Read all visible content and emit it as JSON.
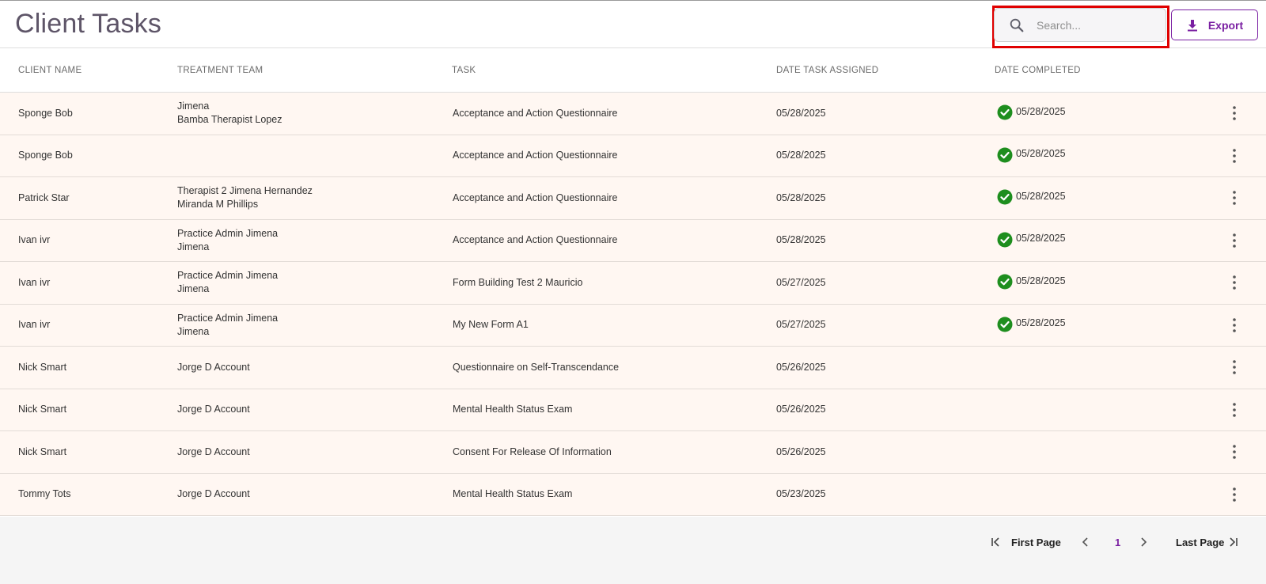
{
  "header": {
    "title": "Client Tasks",
    "search_placeholder": "Search...",
    "export_label": "Export"
  },
  "table": {
    "columns": [
      "CLIENT NAME",
      "TREATMENT TEAM",
      "TASK",
      "DATE TASK ASSIGNED",
      "DATE COMPLETED"
    ],
    "rows": [
      {
        "client": "Sponge Bob",
        "team": [
          "Jimena",
          "Bamba Therapist Lopez"
        ],
        "task": "Acceptance and Action Questionnaire",
        "assigned": "05/28/2025",
        "completed": "05/28/2025"
      },
      {
        "client": "Sponge Bob",
        "team": [],
        "task": "Acceptance and Action Questionnaire",
        "assigned": "05/28/2025",
        "completed": "05/28/2025"
      },
      {
        "client": "Patrick Star",
        "team": [
          "Therapist 2 Jimena Hernandez",
          "Miranda M Phillips"
        ],
        "task": "Acceptance and Action Questionnaire",
        "assigned": "05/28/2025",
        "completed": "05/28/2025"
      },
      {
        "client": "Ivan ivr",
        "team": [
          "Practice Admin Jimena",
          "Jimena"
        ],
        "task": "Acceptance and Action Questionnaire",
        "assigned": "05/28/2025",
        "completed": "05/28/2025"
      },
      {
        "client": "Ivan ivr",
        "team": [
          "Practice Admin Jimena",
          "Jimena"
        ],
        "task": "Form Building Test 2 Mauricio",
        "assigned": "05/27/2025",
        "completed": "05/28/2025"
      },
      {
        "client": "Ivan ivr",
        "team": [
          "Practice Admin Jimena",
          "Jimena"
        ],
        "task": "My New Form A1",
        "assigned": "05/27/2025",
        "completed": "05/28/2025"
      },
      {
        "client": "Nick Smart",
        "team": [
          "Jorge D Account"
        ],
        "task": "Questionnaire on Self-Transcendance",
        "assigned": "05/26/2025",
        "completed": ""
      },
      {
        "client": "Nick Smart",
        "team": [
          "Jorge D Account"
        ],
        "task": "Mental Health Status Exam",
        "assigned": "05/26/2025",
        "completed": ""
      },
      {
        "client": "Nick Smart",
        "team": [
          "Jorge D Account"
        ],
        "task": "Consent For Release Of Information",
        "assigned": "05/26/2025",
        "completed": ""
      },
      {
        "client": "Tommy Tots",
        "team": [
          "Jorge D Account"
        ],
        "task": "Mental Health Status Exam",
        "assigned": "05/23/2025",
        "completed": ""
      }
    ]
  },
  "pagination": {
    "first_label": "First Page",
    "current_page": "1",
    "last_label": "Last Page"
  },
  "colors": {
    "accent": "#7a1fa2",
    "row_bg": "#fff7f2",
    "check_green": "#1e8e1e",
    "highlight_red": "#e00000"
  },
  "icons": {
    "search": "search-icon",
    "export": "download-icon",
    "completed": "check-circle-icon",
    "row_menu": "more-vertical-icon",
    "first": "first-page-icon",
    "prev": "chevron-left-icon",
    "next": "chevron-right-icon",
    "last": "last-page-icon"
  }
}
